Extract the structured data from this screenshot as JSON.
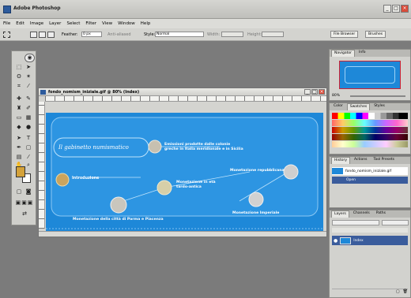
{
  "app": {
    "title": "Adobe Photoshop"
  },
  "window_buttons": [
    "_",
    "□",
    "×"
  ],
  "menu": [
    "File",
    "Edit",
    "Image",
    "Layer",
    "Select",
    "Filter",
    "View",
    "Window",
    "Help"
  ],
  "options": {
    "feather_label": "Feather:",
    "feather_value": "0 px",
    "antialias_label": "Anti-aliased",
    "style_label": "Style:",
    "style_value": "Normal",
    "width_label": "Width:",
    "height_label": "Height:",
    "file_browser": "File Browser",
    "brushes": "Brushes"
  },
  "document": {
    "title": "fondo_nomism_iniziale.gif @ 80% (Index)"
  },
  "canvas": {
    "heading": "Il gabinetto numismatico",
    "items": [
      {
        "label": "Introduzione"
      },
      {
        "label": "Emissioni prodotte dalle colonie greche in Italia meridionale e in Sicilia"
      },
      {
        "label": "Monetazione in età tardo-antica"
      },
      {
        "label": "Monetazione repubblicana"
      },
      {
        "label": "Monetazione della città di Parma e Piacenza"
      },
      {
        "label": "Monetazione Imperiale"
      }
    ]
  },
  "navigator": {
    "tabs": [
      "Navigator",
      "Info"
    ],
    "zoom": "80%"
  },
  "color_panel": {
    "tabs": [
      "Color",
      "Swatches",
      "Styles"
    ]
  },
  "history_panel": {
    "tabs": [
      "History",
      "Actions",
      "Tool Presets"
    ],
    "items": [
      "fondo_nomism_iniziale.gif",
      "Open"
    ]
  },
  "layers_panel": {
    "tabs": [
      "Layers",
      "Channels",
      "Paths"
    ],
    "layer_name": "Index"
  },
  "colors": {
    "canvas_bg": "#1e88d8",
    "accent": "#2d5b9c"
  }
}
